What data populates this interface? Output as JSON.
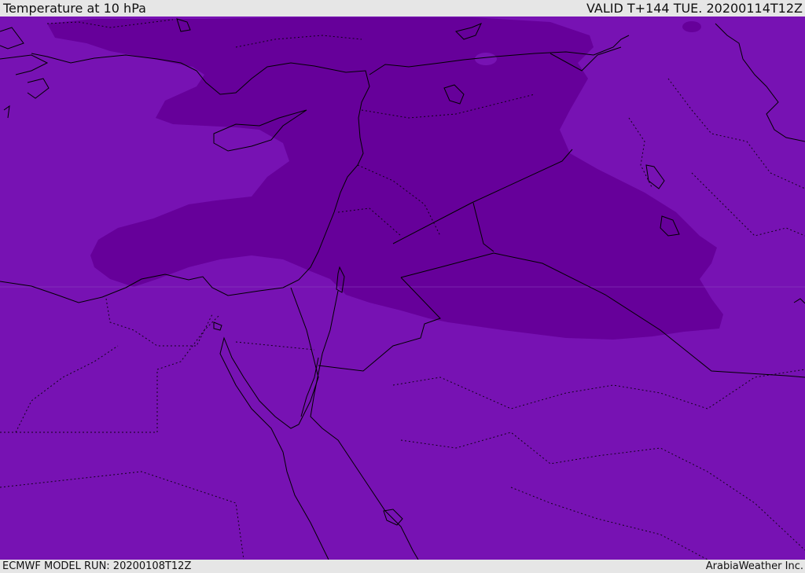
{
  "header": {
    "title": "Temperature at 10 hPa",
    "valid_time": "VALID T+144 TUE. 20200114T12Z"
  },
  "footer": {
    "model_run": "ECMWF MODEL RUN: 20200108T12Z",
    "credit": "ArabiaWeather Inc."
  },
  "colors": {
    "background_field": "#7712b3",
    "cold_region": "#66009a",
    "coastline": "#000000"
  }
}
